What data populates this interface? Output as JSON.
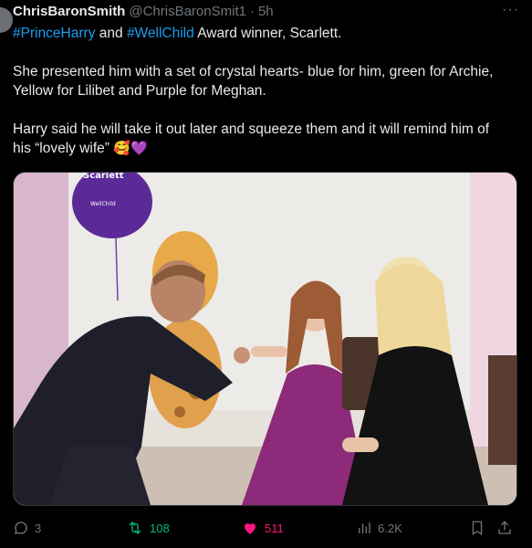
{
  "tweet": {
    "author_name": "ChrisBaronSmith",
    "author_handle": "@ChrisBaronSmit1",
    "separator": "·",
    "time": "5h",
    "more_label": "···",
    "hashtag1": "#PrinceHarry",
    "text_and": " and ",
    "hashtag2": "#WellChild",
    "line1_rest": " Award winner, Scarlett.",
    "paragraph2": "She presented him with a set of crystal hearts- blue for him, green for Archie, Yellow for Lilibet and Purple for Meghan.",
    "paragraph3": "Harry said he will take it out later and squeeze them and it will remind him of his “lovely wife”",
    "emoji": "🥰💜"
  },
  "photo": {
    "balloon_text_top": "Scarlett",
    "balloon_text_logo": "WellChild"
  },
  "actions": {
    "replies": "3",
    "retweets": "108",
    "likes": "511",
    "views": "6.2K"
  },
  "colors": {
    "background": "#000000",
    "text": "#e7e9ea",
    "muted": "#71767b",
    "link": "#1d9bf0",
    "retweet_active": "#00ba7c",
    "like_active": "#f91880"
  }
}
